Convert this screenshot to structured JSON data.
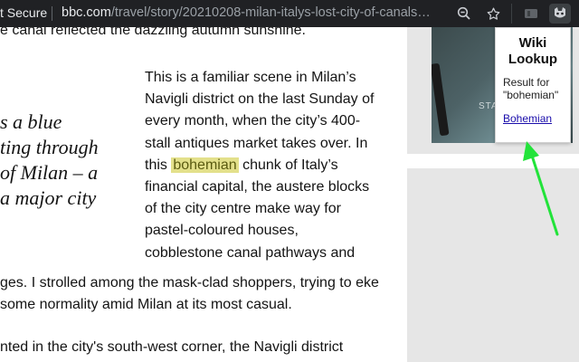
{
  "browser": {
    "security_label": "t Secure",
    "url_host": "bbc.com",
    "url_path": "/travel/story/20210208-milan-italys-lost-city-of-canals",
    "url_ellipsis": "…"
  },
  "article": {
    "top_line": "e canal reflected the dazzling autumn sunshine.",
    "pullquote": [
      "s a blue",
      "ting through",
      "of Milan – a",
      "a major city"
    ],
    "para_before": [
      "This is a familiar scene in Milan’s",
      "Navigli district on the last Sunday of",
      "every month, when the city’s 400-",
      "stall antiques market takes over. In"
    ],
    "highlight_prefix": "this ",
    "highlight_word": "bohemian",
    "highlight_suffix": " chunk of Italy’s",
    "para_after": [
      "financial capital, the austere blocks",
      "of the city centre make way for",
      "pastel-coloured houses,",
      "cobblestone canal pathways and"
    ],
    "wide_line_1": "ges. I strolled among the mask-clad shoppers, trying to eke",
    "wide_line_2": "some normality amid Milan at its most casual.",
    "wide_line_3": "nted in the city's south-west corner, the Navigli district"
  },
  "ad": {
    "photo_text": "STA"
  },
  "popup": {
    "title": "Wiki Lookup",
    "result_text": "Result for \"bohemian\"",
    "link_text": "Bohemian"
  },
  "colors": {
    "highlight": "#e3e08b",
    "arrow": "#22e33a",
    "link": "#1a0dab"
  }
}
